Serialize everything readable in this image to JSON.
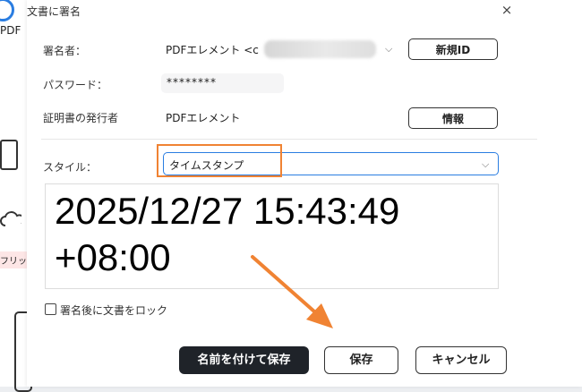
{
  "background": {
    "app_label": "PDF",
    "tag_text": "フリッ"
  },
  "dialog": {
    "title": "文書に署名",
    "close_symbol": "×",
    "signer": {
      "label": "署名者：",
      "value": "PDFエレメント <c",
      "new_id_button": "新規ID"
    },
    "password": {
      "label": "パスワード：",
      "value": "********"
    },
    "issuer": {
      "label": "証明書の発行者",
      "value": "PDFエレメント",
      "info_button": "情報"
    },
    "style": {
      "label": "スタイル：",
      "selected": "タイムスタンプ"
    },
    "preview": {
      "line1": "2025/12/27 15:43:49",
      "line2": "+08:00"
    },
    "lock_checkbox": {
      "label": "署名後に文書をロック",
      "checked": false
    },
    "buttons": {
      "save_as": "名前を付けて保存",
      "save": "保存",
      "cancel": "キャンセル"
    },
    "colors": {
      "accent": "#2a7de1",
      "highlight": "#f08333",
      "dark_button": "#1f2329"
    }
  }
}
